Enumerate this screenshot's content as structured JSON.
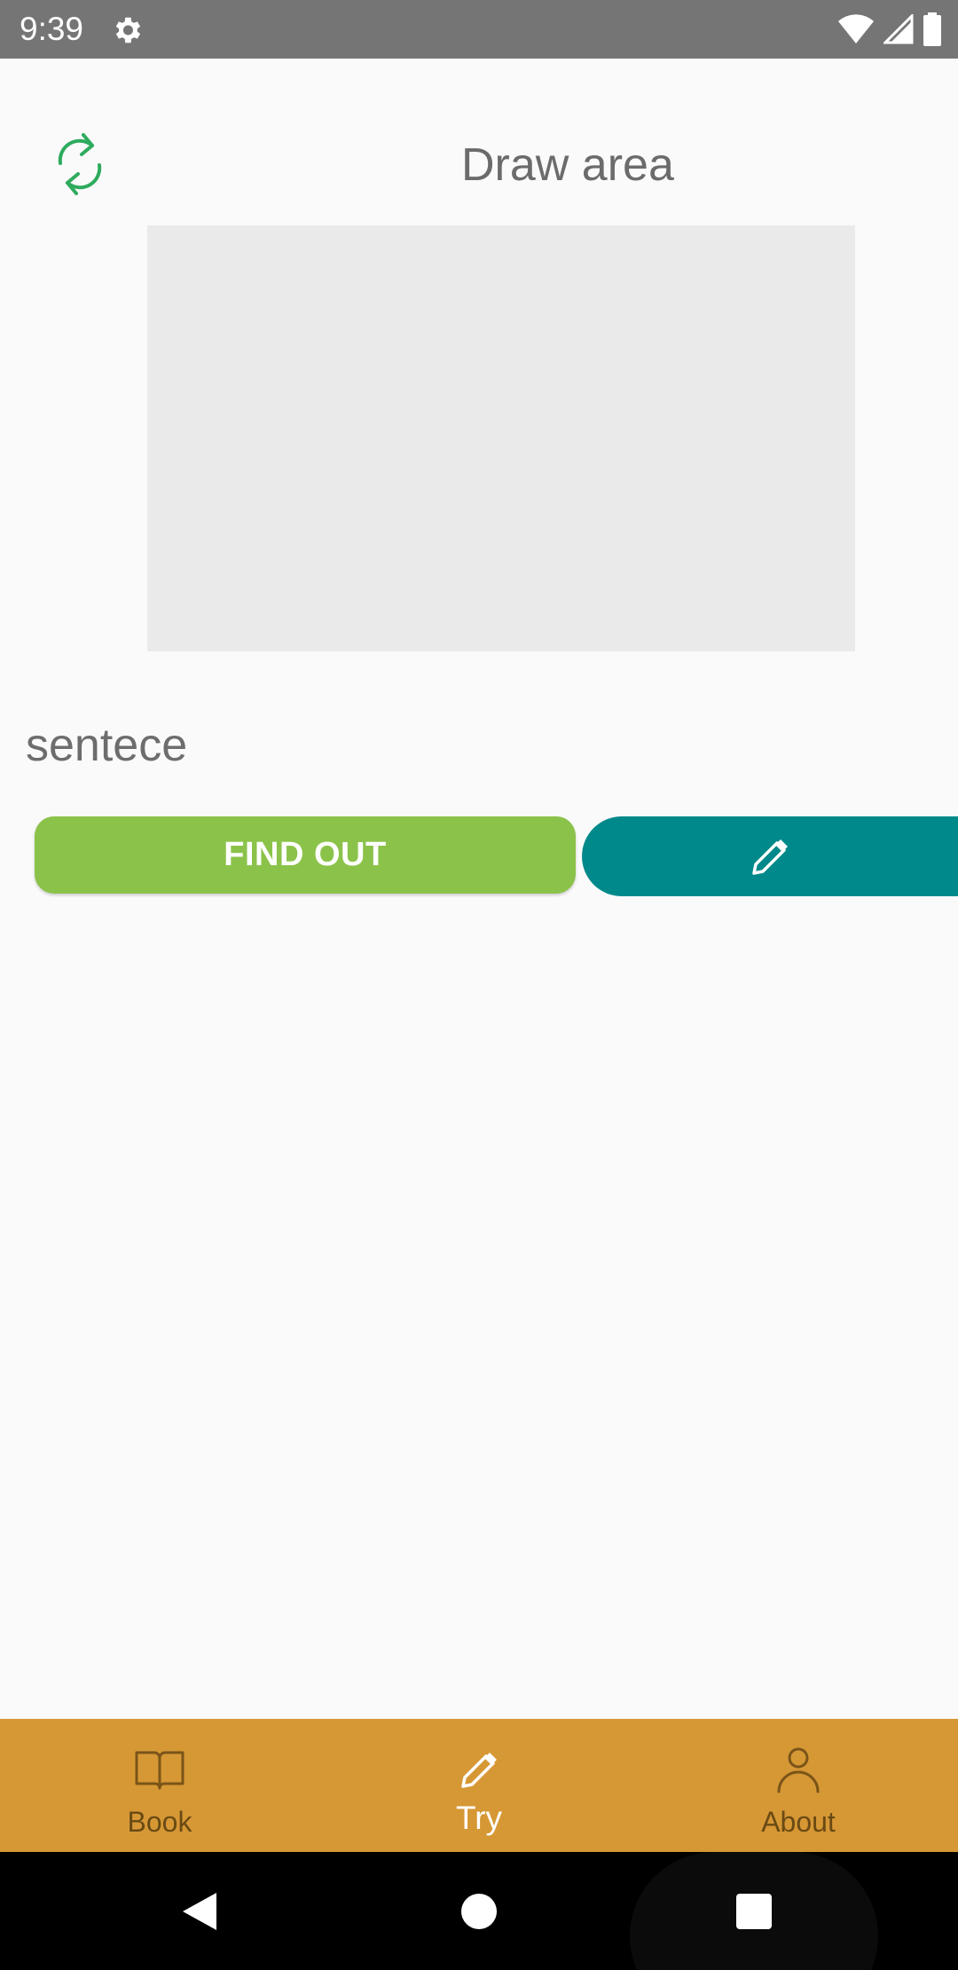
{
  "status_bar": {
    "time": "9:39",
    "icons": [
      "gear-icon",
      "wifi-icon",
      "cellular-signal-icon",
      "battery-icon"
    ]
  },
  "header": {
    "title": "Draw area",
    "refresh_icon": "refresh-icon"
  },
  "sentence": {
    "text": "sentece"
  },
  "buttons": {
    "find_out_label": "FIND OUT",
    "edit_icon": "pencil-icon"
  },
  "bottom_nav": {
    "items": [
      {
        "label": "Book",
        "icon": "book-icon",
        "active": false
      },
      {
        "label": "Try",
        "icon": "pencil-icon",
        "active": true
      },
      {
        "label": "About",
        "icon": "person-icon",
        "active": false
      }
    ]
  },
  "system_nav": {
    "buttons": [
      "back-icon",
      "home-icon",
      "recents-icon"
    ]
  },
  "colors": {
    "status_bar": "#757575",
    "background": "#fafafa",
    "canvas": "#eaeaea",
    "find_out": "#8bc34a",
    "edit": "#00898a",
    "bottom_nav": "#d69835",
    "refresh_icon": "#2eab5d"
  }
}
